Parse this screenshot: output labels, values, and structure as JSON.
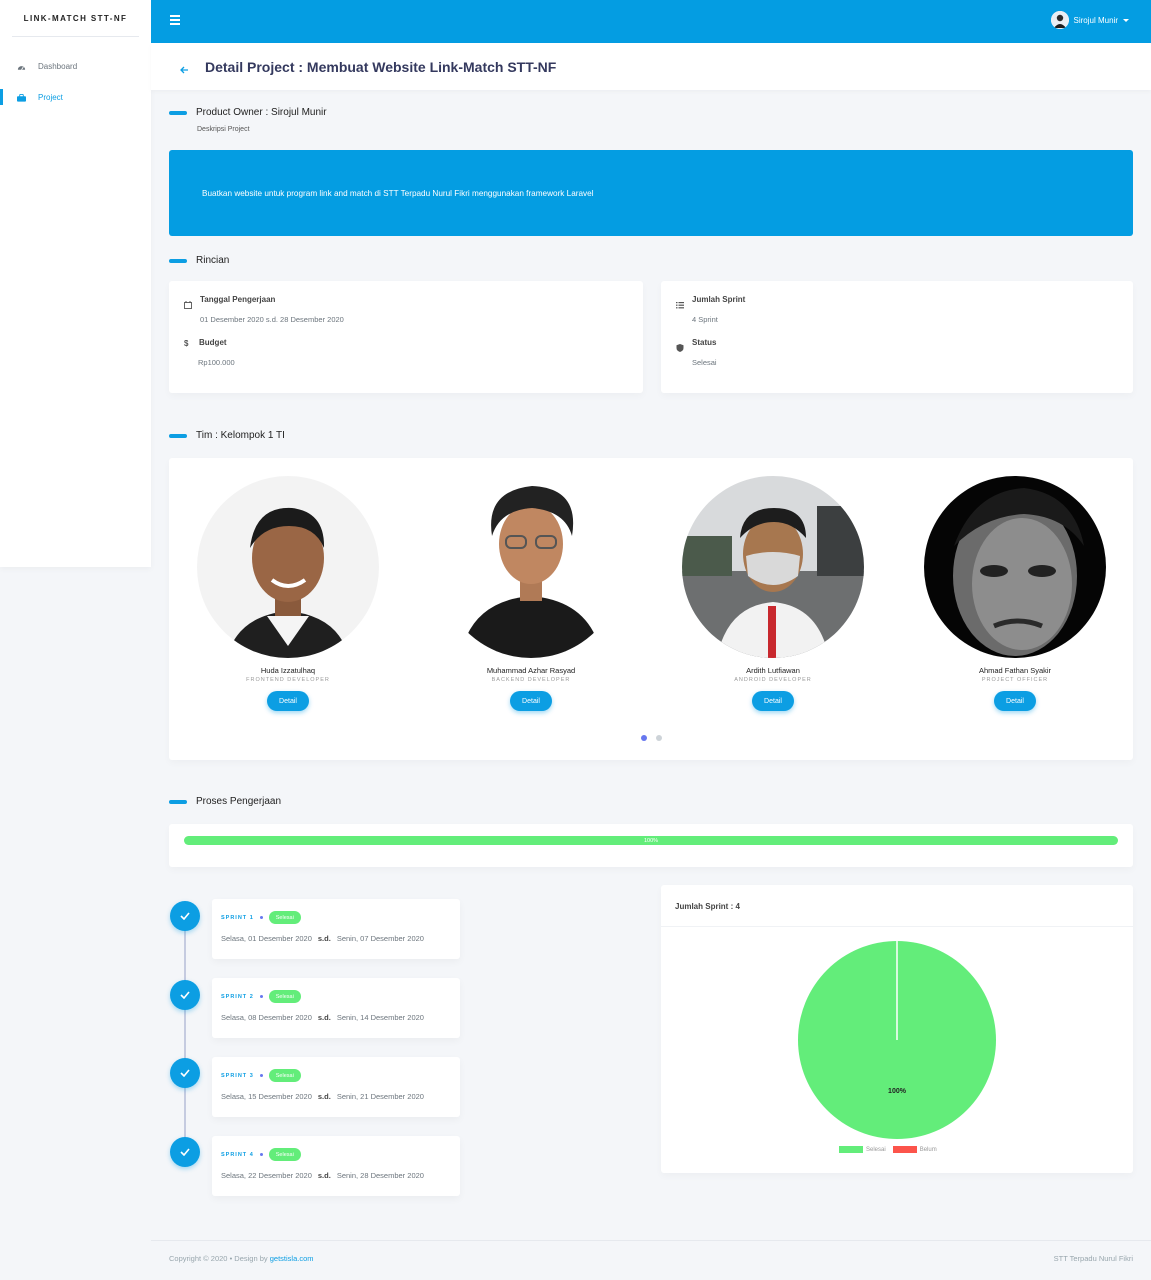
{
  "sidebar": {
    "brand": "LINK-MATCH STT-NF",
    "items": [
      {
        "label": "Dashboard",
        "icon": "dashboard-icon"
      },
      {
        "label": "Project",
        "icon": "briefcase-icon"
      }
    ]
  },
  "topbar": {
    "user_name": "Sirojul Munir"
  },
  "header": {
    "title": "Detail Project : Membuat Website Link-Match STT-NF"
  },
  "owner": {
    "title": "Product Owner : Sirojul Munir",
    "subtitle": "Deskripsi Project"
  },
  "description": "Buatkan website untuk program link and match di STT Terpadu Nurul Fikri menggunakan framework Laravel",
  "rincian": {
    "title": "Rincian",
    "tanggal_label": "Tanggal Pengerjaan",
    "tanggal_value": "01 Desember 2020 s.d. 28 Desember 2020",
    "budget_label": "Budget",
    "budget_value": "Rp100.000",
    "sprint_label": "Jumlah Sprint",
    "sprint_value": "4 Sprint",
    "status_label": "Status",
    "status_value": "Selesai"
  },
  "team": {
    "title": "Tim : Kelompok 1 TI",
    "detail_label": "Detail",
    "members": [
      {
        "name": "Huda Izzatulhaq",
        "role": "FRONTEND DEVELOPER"
      },
      {
        "name": "Muhammad Azhar Rasyad",
        "role": "BACKEND DEVELOPER"
      },
      {
        "name": "Ardith Lutfiawan",
        "role": "ANDROID DEVELOPER"
      },
      {
        "name": "Ahmad Fathan Syakir",
        "role": "PROJECT OFFICER"
      }
    ]
  },
  "progress": {
    "title": "Proses Pengerjaan",
    "label": "100%",
    "value": 100,
    "color": "#63ed7a"
  },
  "sprints": [
    {
      "label": "SPRINT 1",
      "status": "Selesai",
      "start": "Selasa, 01 Desember 2020",
      "sd": "s.d.",
      "end": "Senin, 07 Desember 2020"
    },
    {
      "label": "SPRINT 2",
      "status": "Selesai",
      "start": "Selasa, 08 Desember 2020",
      "sd": "s.d.",
      "end": "Senin, 14 Desember 2020"
    },
    {
      "label": "SPRINT 3",
      "status": "Selesai",
      "start": "Selasa, 15 Desember 2020",
      "sd": "s.d.",
      "end": "Senin, 21 Desember 2020"
    },
    {
      "label": "SPRINT 4",
      "status": "Selesai",
      "start": "Selasa, 22 Desember 2020",
      "sd": "s.d.",
      "end": "Senin, 28 Desember 2020"
    }
  ],
  "chart_title": "Jumlah Sprint : 4",
  "chart_data": {
    "type": "pie",
    "categories": [
      "Selesai",
      "Belum"
    ],
    "values": [
      100,
      0
    ],
    "colors": [
      "#63ed7a",
      "#fc544b"
    ],
    "data_labels": [
      "100%"
    ]
  },
  "footer": {
    "copyright": "Copyright © 2020",
    "design_by": "Design by",
    "link": "getstisla.com",
    "right": "STT Terpadu Nurul Fikri"
  },
  "colors": {
    "primary": "#049de2",
    "success": "#63ed7a",
    "danger": "#fc544b",
    "indicator": "#6777ef"
  }
}
